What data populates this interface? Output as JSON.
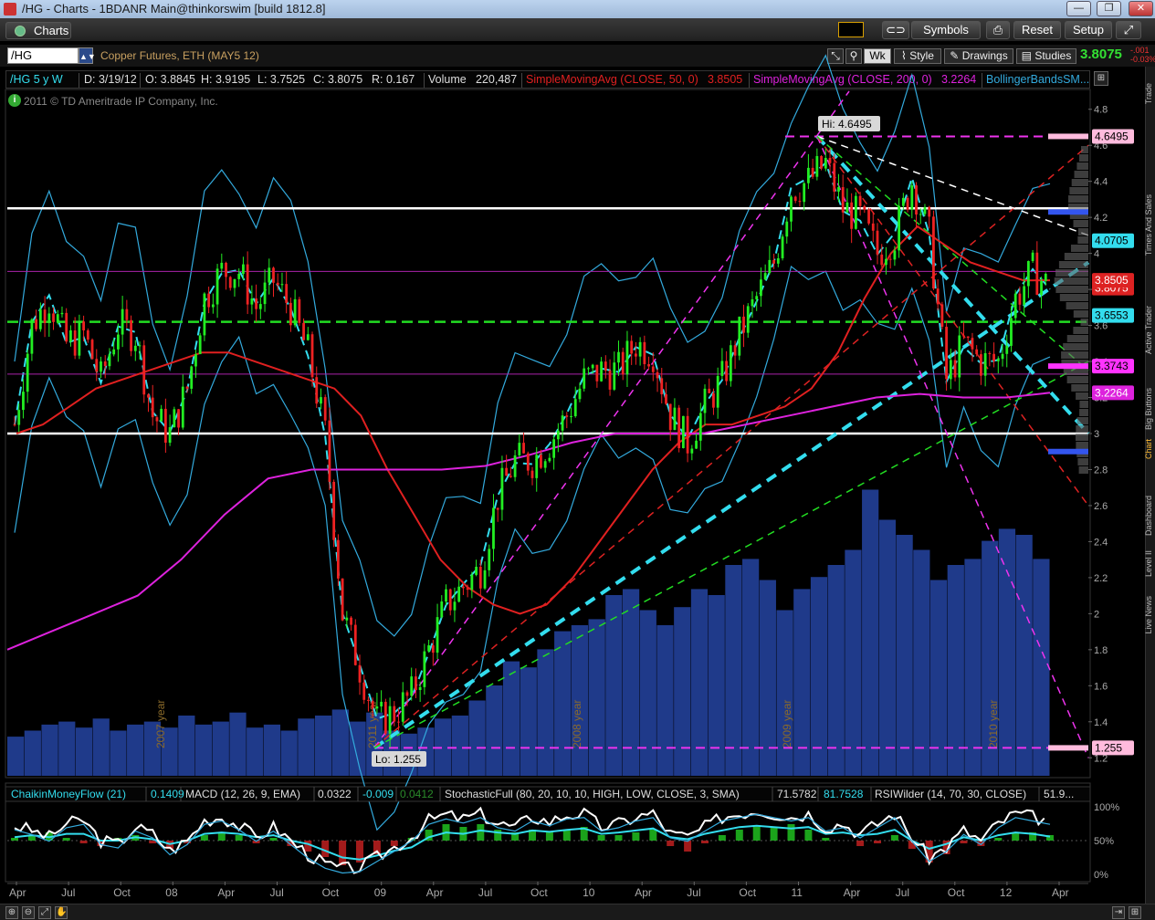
{
  "window": {
    "title": "/HG - Charts - 1BDANR Main@thinkorswim [build 1812.8]",
    "min_icon": "minimize-icon",
    "max_icon": "maximize-icon",
    "close_icon": "close-icon"
  },
  "menu": {
    "tab_label": "Charts",
    "buttons": [
      "Symbols",
      "Reset",
      "Setup"
    ]
  },
  "symbol_bar": {
    "symbol": "/HG",
    "description": "Copper Futures, ETH (MAY5 12)",
    "aggregation": "Wk",
    "style": "Style",
    "drawings": "Drawings",
    "studies": "Studies",
    "last_price": "3.8075",
    "change1": "-.001",
    "change2": "-0.03%"
  },
  "info_bar": {
    "period": "/HG 5 y W",
    "date": "D: 3/19/12",
    "open": "O: 3.8845",
    "high": "H: 3.9195",
    "low": "L: 3.7525",
    "close": "C: 3.8075",
    "range": "R: 0.167",
    "volume_label": "Volume",
    "volume_value": "220,487",
    "sma50_label": "SimpleMovingAvg (CLOSE, 50, 0)",
    "sma50_value": "3.8505",
    "sma200_label": "SimpleMovingAvg (CLOSE, 200, 0)",
    "sma200_value": "3.2264",
    "bb_label": "BollingerBandsSM..."
  },
  "copyright": "2011 © TD Ameritrade IP Company, Inc.",
  "right_tabs": [
    "Trade",
    "Times And Sales",
    "Active Trader",
    "Big Buttons",
    "Chart",
    "Dashboard",
    "Level II",
    "Live News"
  ],
  "colors": {
    "up": "#22ee22",
    "down": "#ee2222",
    "volume": "#1f3a8a",
    "sma50": "#e02020",
    "sma200": "#dd22dd",
    "bollinger": "#33aadd",
    "cyan_trend": "#33ddee",
    "magenta_trend": "#ee33ee",
    "green_level": "#22dd22",
    "white_level": "#ffffff"
  },
  "chart_data": [
    {
      "type": "candlestick",
      "title": "/HG 5 y W",
      "ylim": [
        1.1,
        4.9
      ],
      "y_ticks": [
        "4.8",
        "4.6",
        "4.4",
        "4.2",
        "4",
        "3.8",
        "3.6",
        "3.4",
        "3.2",
        "3",
        "2.8",
        "2.6",
        "2.4",
        "2.2",
        "2",
        "1.8",
        "1.6",
        "1.4",
        "1.2"
      ],
      "x_ticks": [
        "Apr",
        "Jul",
        "Oct",
        "08",
        "Apr",
        "Jul",
        "Oct",
        "09",
        "Apr",
        "Jul",
        "Oct",
        "10",
        "Apr",
        "Jul",
        "Oct",
        "11",
        "Apr",
        "Jul",
        "Oct",
        "12",
        "Apr"
      ],
      "x_range": [
        "2007-03",
        "2012-04"
      ],
      "year_markers": [
        "2007 year",
        "2008 year",
        "2009 year",
        "2010 year",
        "2011 year"
      ],
      "close_series": {
        "dates": [
          "2007-03",
          "2007-04",
          "2007-05",
          "2007-06",
          "2007-07",
          "2007-08",
          "2007-09",
          "2007-10",
          "2007-11",
          "2007-12",
          "2008-01",
          "2008-02",
          "2008-03",
          "2008-04",
          "2008-05",
          "2008-06",
          "2008-07",
          "2008-08",
          "2008-09",
          "2008-10",
          "2008-11",
          "2008-12",
          "2009-01",
          "2009-02",
          "2009-03",
          "2009-04",
          "2009-05",
          "2009-06",
          "2009-07",
          "2009-08",
          "2009-09",
          "2009-10",
          "2009-11",
          "2009-12",
          "2010-01",
          "2010-02",
          "2010-03",
          "2010-04",
          "2010-05",
          "2010-06",
          "2010-07",
          "2010-08",
          "2010-09",
          "2010-10",
          "2010-11",
          "2010-12",
          "2011-01",
          "2011-02",
          "2011-03",
          "2011-04",
          "2011-05",
          "2011-06",
          "2011-07",
          "2011-08",
          "2011-09",
          "2011-10",
          "2011-11",
          "2011-12",
          "2012-01",
          "2012-02",
          "2012-03"
        ],
        "values": [
          3.05,
          3.6,
          3.75,
          3.5,
          3.55,
          3.3,
          3.6,
          3.55,
          3.1,
          3.0,
          3.25,
          3.75,
          3.9,
          3.9,
          3.7,
          3.85,
          3.7,
          3.45,
          3.0,
          2.0,
          1.7,
          1.4,
          1.45,
          1.55,
          1.8,
          2.05,
          2.15,
          2.25,
          2.65,
          2.85,
          2.85,
          2.95,
          3.1,
          3.3,
          3.35,
          3.35,
          3.5,
          3.45,
          3.1,
          2.95,
          3.15,
          3.3,
          3.55,
          3.75,
          3.95,
          4.35,
          4.4,
          4.5,
          4.25,
          4.2,
          4.0,
          4.1,
          4.4,
          4.1,
          3.3,
          3.5,
          3.4,
          3.4,
          3.75,
          3.9,
          3.8075
        ]
      },
      "sma50": [
        3.0,
        3.05,
        3.15,
        3.25,
        3.3,
        3.35,
        3.4,
        3.45,
        3.45,
        3.4,
        3.35,
        3.3,
        3.25,
        3.1,
        2.8,
        2.55,
        2.3,
        2.15,
        2.05,
        2.0,
        2.05,
        2.2,
        2.4,
        2.6,
        2.8,
        2.95,
        3.05,
        3.05,
        3.1,
        3.15,
        3.25,
        3.45,
        3.75,
        4.0,
        4.15,
        4.05,
        3.95,
        3.9,
        3.85,
        3.8505
      ],
      "sma200": [
        1.8,
        1.9,
        2.0,
        2.1,
        2.3,
        2.55,
        2.75,
        2.8,
        2.8,
        2.8,
        2.8,
        2.82,
        2.88,
        2.95,
        3.0,
        3.0,
        3.0,
        3.05,
        3.1,
        3.15,
        3.2,
        3.22,
        3.2,
        3.2,
        3.2264
      ],
      "levels": [
        {
          "name": "4.6495",
          "value": 4.6495,
          "color": "#ee33ee"
        },
        {
          "name": "4.0705",
          "value": 4.0705,
          "color": "#33ddee"
        },
        {
          "name": "3.8075",
          "value": 3.8075,
          "color": "#ee2222"
        },
        {
          "name": "3.6553",
          "value": 3.6553,
          "color": "#33ddee"
        },
        {
          "name": "3.3743",
          "value": 3.3743,
          "color": "#ee33ee"
        },
        {
          "name": "3.2264",
          "value": 3.2264,
          "color": "#ee33ee"
        },
        {
          "name": "1.255",
          "value": 1.255,
          "color": "#ee33ee"
        },
        {
          "name": "3.8505",
          "value": 3.8505,
          "color": "#ee2222"
        }
      ],
      "hline_white": [
        4.25,
        3.0
      ],
      "hline_green": 3.62,
      "annotations": {
        "high": "Hi: 4.6495",
        "low": "Lo: 1.255"
      },
      "volume": [
        0.13,
        0.15,
        0.17,
        0.18,
        0.16,
        0.19,
        0.15,
        0.17,
        0.18,
        0.16,
        0.2,
        0.17,
        0.18,
        0.21,
        0.16,
        0.17,
        0.15,
        0.19,
        0.2,
        0.22,
        0.18,
        0.21,
        0.15,
        0.14,
        0.16,
        0.19,
        0.2,
        0.25,
        0.3,
        0.38,
        0.36,
        0.42,
        0.48,
        0.5,
        0.52,
        0.6,
        0.62,
        0.55,
        0.5,
        0.56,
        0.62,
        0.6,
        0.7,
        0.72,
        0.65,
        0.55,
        0.62,
        0.66,
        0.7,
        0.75,
        0.95,
        0.85,
        0.8,
        0.75,
        0.65,
        0.7,
        0.72,
        0.78,
        0.82,
        0.8,
        0.72
      ]
    },
    {
      "type": "line",
      "title": "Indicators",
      "labels": [
        {
          "name": "ChaikinMoneyFlow (21)",
          "value": "0.1409"
        },
        {
          "name": "MACD (12, 26, 9, EMA)",
          "values": [
            "0.0322",
            "-0.009",
            "0.0412"
          ]
        },
        {
          "name": "StochasticFull (80, 20, 10, 10, HIGH, LOW, CLOSE, 3, SMA)",
          "values": [
            "71.5782",
            "81.7528"
          ]
        },
        {
          "name": "RSIWilder (14, 70, 30, CLOSE)",
          "value": "51.9..."
        }
      ],
      "y_ticks": [
        "100%",
        "50%",
        "0%"
      ],
      "stoch": [
        0.72,
        0.65,
        0.55,
        0.75,
        0.8,
        0.5,
        0.45,
        0.7,
        0.6,
        0.35,
        0.5,
        0.8,
        0.85,
        0.72,
        0.55,
        0.7,
        0.5,
        0.3,
        0.15,
        0.08,
        0.1,
        0.25,
        0.4,
        0.55,
        0.8,
        0.88,
        0.82,
        0.9,
        0.75,
        0.7,
        0.85,
        0.78,
        0.88,
        0.9,
        0.7,
        0.75,
        0.85,
        0.9,
        0.6,
        0.55,
        0.7,
        0.85,
        0.9,
        0.95,
        0.9,
        0.85,
        0.9,
        0.7,
        0.75,
        0.6,
        0.75,
        0.9,
        0.55,
        0.25,
        0.4,
        0.65,
        0.5,
        0.75,
        0.9,
        0.85,
        0.8
      ],
      "rsi": [
        0.55,
        0.58,
        0.55,
        0.6,
        0.6,
        0.5,
        0.5,
        0.55,
        0.52,
        0.45,
        0.5,
        0.6,
        0.62,
        0.6,
        0.55,
        0.58,
        0.5,
        0.45,
        0.35,
        0.25,
        0.22,
        0.28,
        0.35,
        0.4,
        0.55,
        0.62,
        0.6,
        0.65,
        0.62,
        0.6,
        0.65,
        0.63,
        0.66,
        0.68,
        0.6,
        0.62,
        0.65,
        0.68,
        0.55,
        0.52,
        0.6,
        0.65,
        0.7,
        0.72,
        0.7,
        0.68,
        0.7,
        0.6,
        0.62,
        0.58,
        0.6,
        0.66,
        0.5,
        0.38,
        0.45,
        0.55,
        0.5,
        0.58,
        0.62,
        0.6,
        0.56
      ],
      "macd_hist": [
        0.1,
        0.2,
        0.3,
        0.1,
        -0.1,
        -0.2,
        0.1,
        0.2,
        -0.1,
        -0.3,
        -0.1,
        0.2,
        0.3,
        0.2,
        -0.1,
        0.1,
        -0.2,
        -0.4,
        -0.6,
        -0.9,
        -0.8,
        -0.5,
        -0.2,
        0.1,
        0.4,
        0.6,
        0.5,
        0.6,
        0.4,
        0.3,
        0.4,
        0.3,
        0.4,
        0.5,
        0.2,
        0.2,
        0.3,
        0.4,
        -0.2,
        -0.4,
        -0.1,
        0.2,
        0.4,
        0.5,
        0.5,
        0.6,
        0.4,
        0.1,
        0.0,
        -0.2,
        -0.1,
        0.2,
        -0.3,
        -0.8,
        -0.5,
        -0.1,
        -0.2,
        0.1,
        0.3,
        0.3,
        0.2
      ]
    }
  ]
}
